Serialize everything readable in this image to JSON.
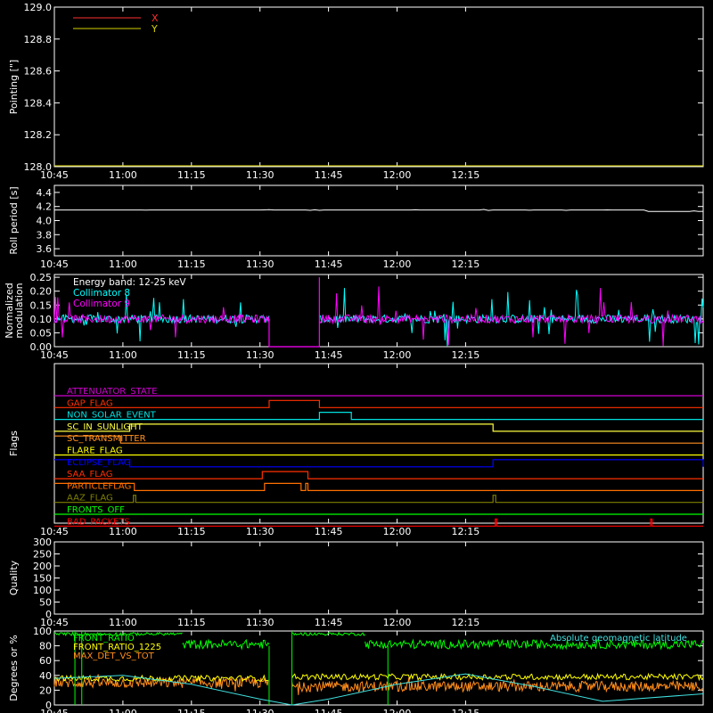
{
  "chart_data": [
    {
      "type": "line",
      "ylabel": "Pointing [\"]",
      "ylim": [
        128.0,
        129.0
      ],
      "yticks": [
        "128.0",
        "128.2",
        "128.4",
        "128.6",
        "128.8",
        "129.0"
      ],
      "xticks": [
        "10:45",
        "11:00",
        "11:15",
        "11:30",
        "11:45",
        "12:00",
        "12:15"
      ],
      "legend_position": "top-left",
      "series": [
        {
          "name": "X",
          "color": "#ff3030"
        },
        {
          "name": "Y",
          "color": "#d8d200"
        }
      ],
      "note": "no data visible in range"
    },
    {
      "type": "line",
      "ylabel": "Roll period [s]",
      "ylim": [
        3.5,
        4.5
      ],
      "yticks": [
        "3.6",
        "3.8",
        "4.0",
        "4.2",
        "4.4"
      ],
      "xticks": [
        "10:45",
        "11:00",
        "11:15",
        "11:30",
        "11:45",
        "12:00",
        "12:15"
      ],
      "series": [
        {
          "color": "#ffffff",
          "x_minutes": [
            0,
            60,
            120,
            128,
            130,
            142
          ],
          "y": [
            4.15,
            4.15,
            4.15,
            4.15,
            4.13,
            4.13
          ]
        }
      ]
    },
    {
      "type": "line",
      "ylabel": [
        "Normalized",
        "modulation"
      ],
      "ylim": [
        0.0,
        0.26
      ],
      "yticks": [
        "0.00",
        "0.05",
        "0.10",
        "0.15",
        "0.20",
        "0.25"
      ],
      "xticks": [
        "10:45",
        "11:00",
        "11:15",
        "11:30",
        "11:45",
        "12:00",
        "12:15"
      ],
      "annotation": "Energy band: 12-25 keV",
      "gap_minutes": [
        47,
        58
      ],
      "series": [
        {
          "name": "Collimator 8",
          "color": "#00ffff",
          "baseline": 0.1
        },
        {
          "name": "Collimator 9",
          "color": "#ff00ff",
          "baseline": 0.1
        }
      ]
    },
    {
      "type": "line",
      "ylabel": "Flags",
      "xticks": [
        "10:45",
        "11:00",
        "11:15",
        "11:30",
        "11:45",
        "12:00",
        "12:15"
      ],
      "flags": [
        {
          "name": "ATTENUATOR_STATE",
          "color": "#d000d0",
          "high": []
        },
        {
          "name": "GAP_FLAG",
          "color": "#ff3000",
          "high": [
            [
              47,
              58
            ]
          ]
        },
        {
          "name": "NON_SOLAR_EVENT",
          "color": "#00e0e0",
          "high": [
            [
              58,
              65
            ]
          ]
        },
        {
          "name": "SC_IN_SUNLIGHT",
          "color": "#ffff40",
          "high": [
            [
              16.5,
              96
            ]
          ]
        },
        {
          "name": "SC_TRANSMITTER",
          "color": "#ff9020",
          "high": [
            [
              0,
              14.5
            ]
          ]
        },
        {
          "name": "FLARE_FLAG",
          "color": "#ffff00",
          "high": []
        },
        {
          "name": "ECLIPSE_FLAG",
          "color": "#0000ff",
          "high": [
            [
              0,
              16.5
            ],
            [
              96,
              142
            ]
          ]
        },
        {
          "name": "SAA_FLAG",
          "color": "#ff3000",
          "high": [
            [
              45.5,
              55.5
            ]
          ]
        },
        {
          "name": "PARTICLEFLAG",
          "color": "#ff7000",
          "high": [
            [
              0,
              17.5
            ],
            [
              46,
              54
            ],
            [
              55,
              55.5
            ]
          ]
        },
        {
          "name": "AAZ_FLAG",
          "color": "#808000",
          "high": [
            [
              17.3,
              17.8
            ],
            [
              96,
              96.6
            ]
          ]
        },
        {
          "name": "FRONTS_OFF",
          "color": "#00ff00",
          "high": []
        },
        {
          "name": "BAD_PACKETS",
          "color": "#ff0000",
          "high": [
            [
              96.5,
              96.8
            ],
            [
              130.5,
              130.8
            ]
          ]
        }
      ]
    },
    {
      "type": "line",
      "ylabel": "Quality",
      "ylim": [
        0,
        300
      ],
      "yticks": [
        "0",
        "50",
        "100",
        "150",
        "200",
        "250",
        "300"
      ],
      "xticks": [
        "10:45",
        "11:00",
        "11:15",
        "11:30",
        "11:45",
        "12:00",
        "12:15"
      ],
      "note": "no data visible in range"
    },
    {
      "type": "line",
      "ylabel": "Degrees or %",
      "ylim": [
        0,
        100
      ],
      "yticks": [
        "0",
        "20",
        "40",
        "60",
        "80",
        "100"
      ],
      "xticks": [
        "10:45",
        "11:00",
        "11:15",
        "11:30",
        "11:45",
        "12:00",
        "12:15"
      ],
      "legend_left": [
        "FRONT_RATIO",
        "FRONT_RATIO_1225",
        "MAX_DET_VS_TOT"
      ],
      "legend_right": "Absolute geomagnetic latitude",
      "series": [
        {
          "name": "FRONT_RATIO",
          "color": "#00ff00"
        },
        {
          "name": "FRONT_RATIO_1225",
          "color": "#ffff00"
        },
        {
          "name": "MAX_DET_VS_TOT",
          "color": "#ff8c1a"
        },
        {
          "name": "Absolute geomagnetic latitude",
          "color": "#40e0e0",
          "x_minutes": [
            0,
            15,
            30,
            45,
            52,
            60,
            75,
            90,
            105,
            120,
            142
          ],
          "y": [
            36,
            40,
            28,
            8,
            0,
            8,
            28,
            42,
            25,
            5,
            15
          ]
        }
      ]
    }
  ]
}
